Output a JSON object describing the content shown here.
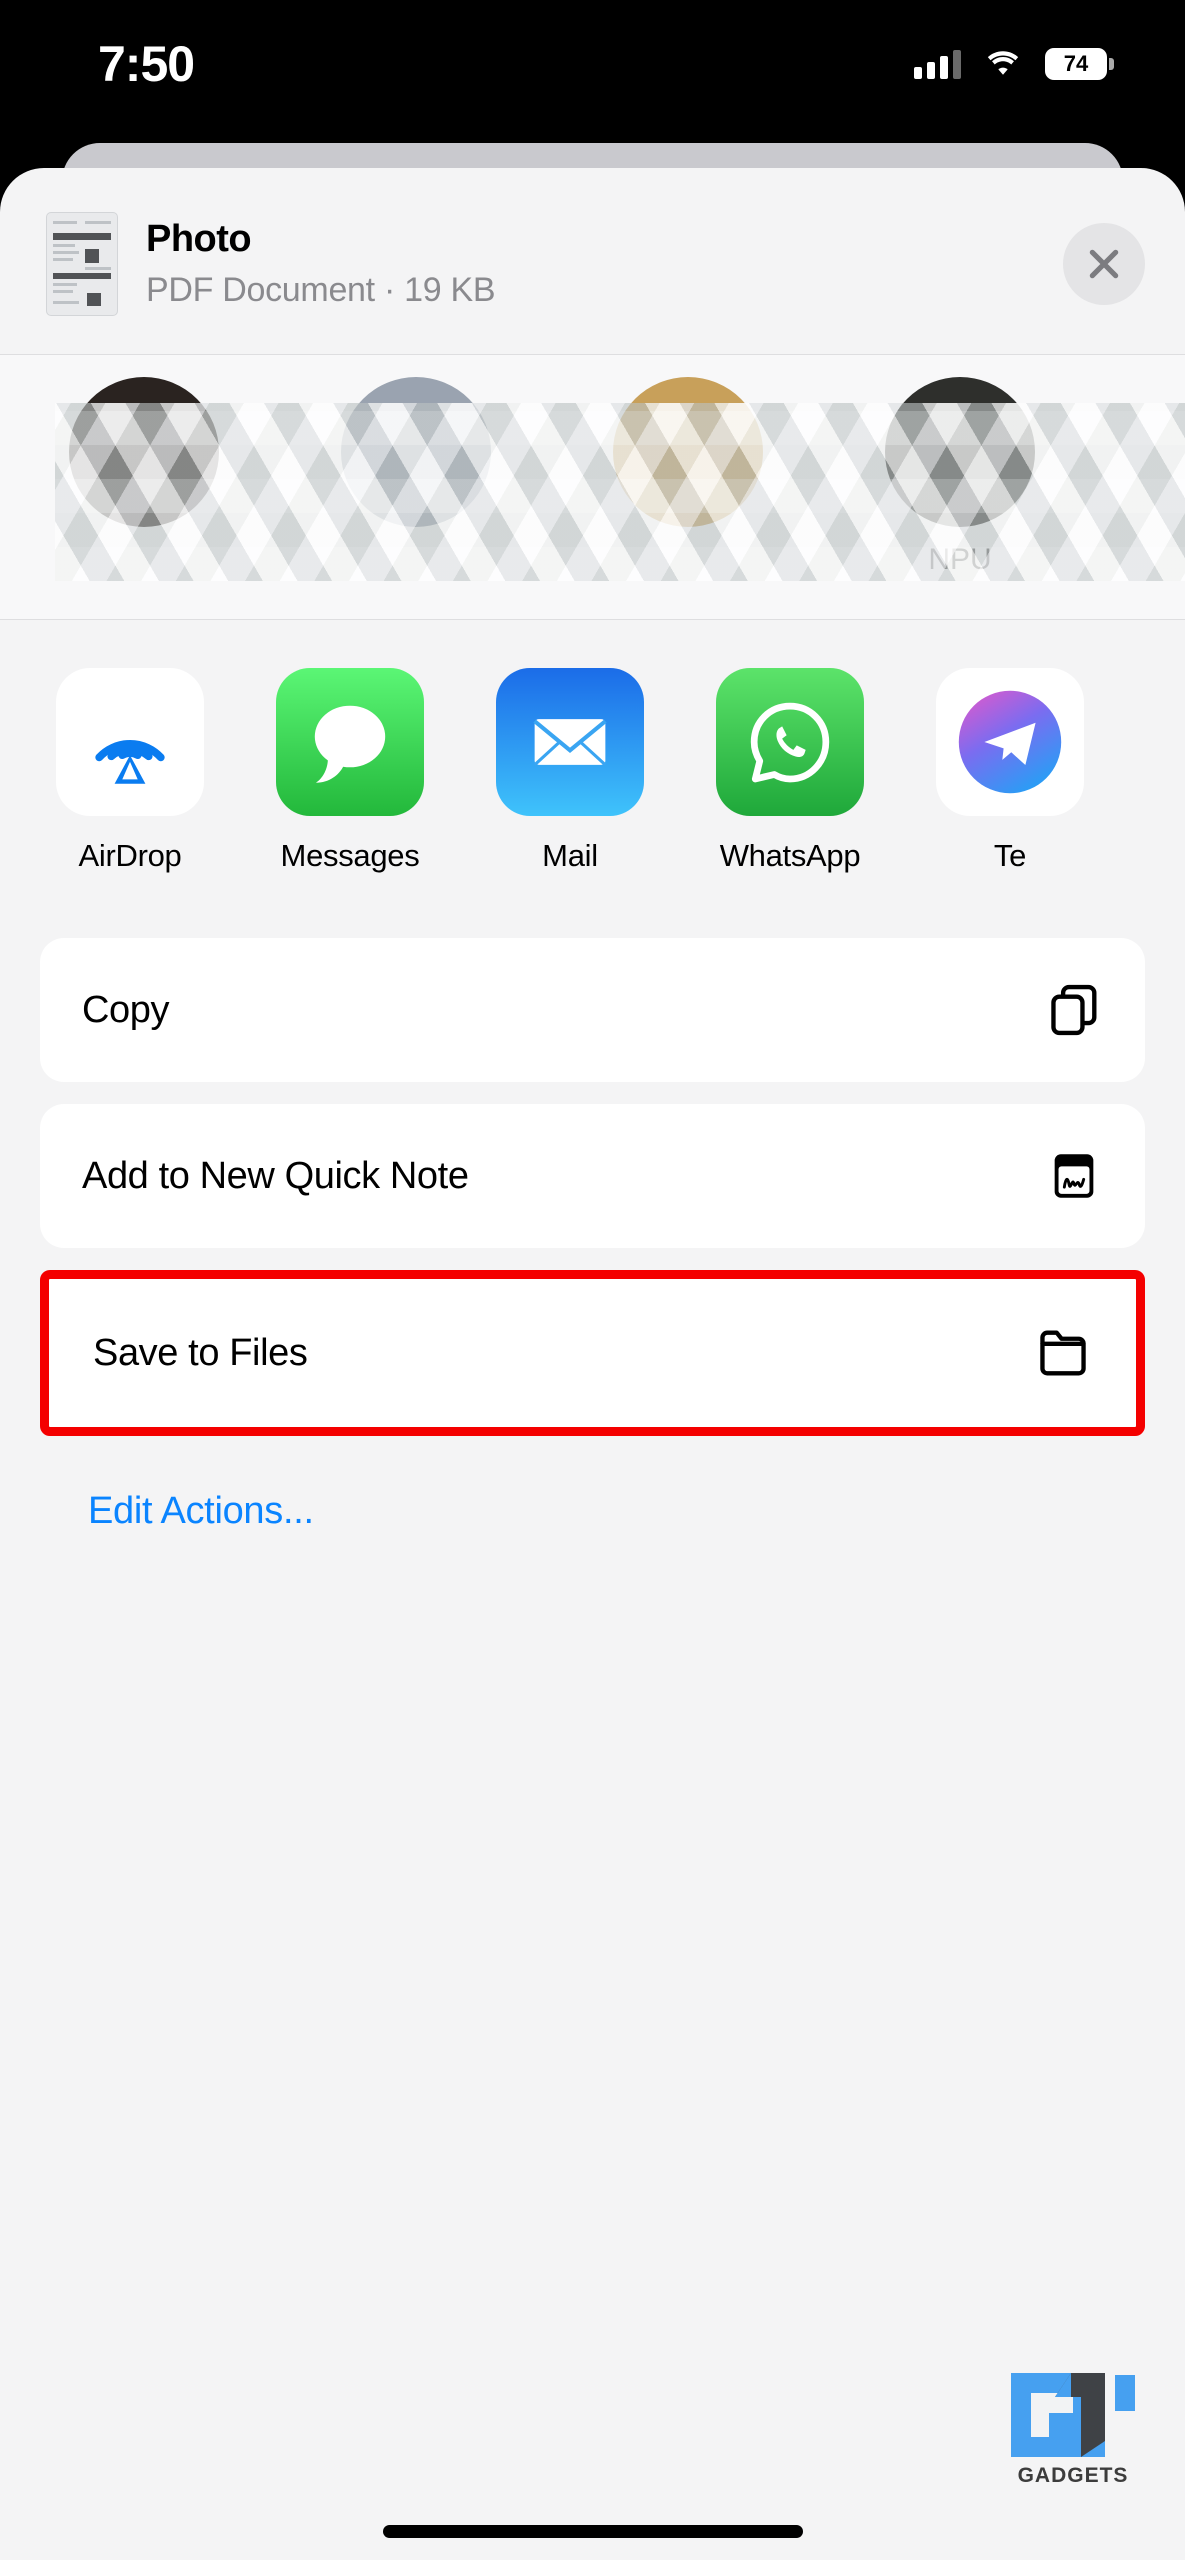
{
  "status_bar": {
    "time": "7:50",
    "battery_level": "74",
    "cellular_icon": "cellular-bars-icon",
    "wifi_icon": "wifi-icon",
    "battery_icon": "battery-icon"
  },
  "share_sheet": {
    "document": {
      "title": "Photo",
      "subtitle": "PDF Document · 19 KB",
      "thumbnail_icon": "pdf-page-thumbnail"
    },
    "close_label": "Close",
    "close_icon": "close-x-icon",
    "contacts": [
      {
        "name": "",
        "avatar_icon": "contact-avatar",
        "blurred": true
      },
      {
        "name": "",
        "avatar_icon": "contact-avatar",
        "blurred": true
      },
      {
        "name": "",
        "avatar_icon": "contact-avatar",
        "blurred": true
      },
      {
        "name": "NPU",
        "avatar_icon": "contact-avatar",
        "blurred": true
      }
    ],
    "apps": [
      {
        "label": "AirDrop",
        "icon": "airdrop-icon"
      },
      {
        "label": "Messages",
        "icon": "messages-icon"
      },
      {
        "label": "Mail",
        "icon": "mail-icon"
      },
      {
        "label": "WhatsApp",
        "icon": "whatsapp-icon"
      },
      {
        "label": "Te",
        "icon": "telegram-icon"
      }
    ],
    "actions": [
      {
        "label": "Copy",
        "icon": "copy-icon",
        "highlighted": false
      },
      {
        "label": "Add to New Quick Note",
        "icon": "quick-note-icon",
        "highlighted": false
      },
      {
        "label": "Save to Files",
        "icon": "folder-icon",
        "highlighted": true
      }
    ],
    "edit_actions_label": "Edit Actions..."
  },
  "watermark": {
    "text": "GADGETS",
    "logo_icon": "gt-logo-icon"
  },
  "colors": {
    "accent_blue": "#0a84ff",
    "highlight_red": "#f40000",
    "sheet_background": "#f4f4f5",
    "row_background": "#ffffff",
    "subtitle_grey": "#8a8a8e"
  }
}
